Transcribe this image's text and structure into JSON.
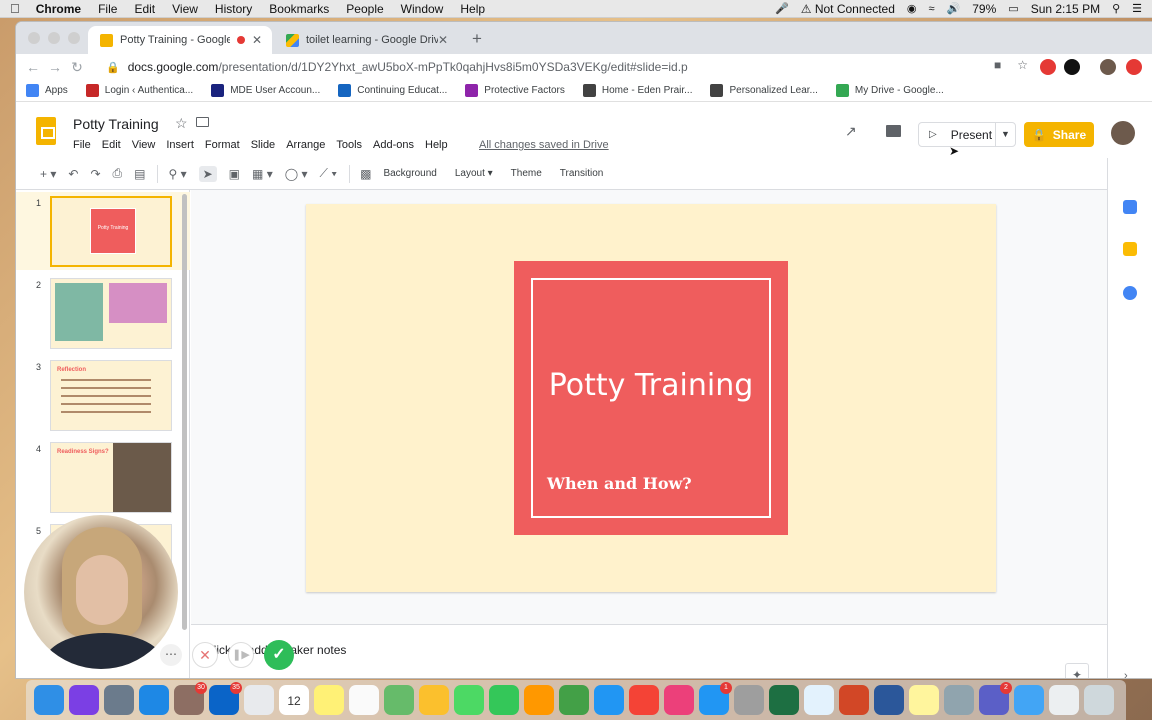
{
  "menubar": {
    "app": "Chrome",
    "items": [
      "File",
      "Edit",
      "View",
      "History",
      "Bookmarks",
      "People",
      "Window",
      "Help"
    ],
    "network": "Not Connected",
    "battery": "79%",
    "clock": "Sun 2:15 PM"
  },
  "browser": {
    "tabs": [
      {
        "title": "Potty Training - Google Sli",
        "favicon_color": "#f4b400"
      },
      {
        "title": "toilet learning - Google Drive",
        "favicon_color": "#34a853"
      }
    ],
    "url_host": "docs.google.com",
    "url_path": "/presentation/d/1DY2Yhxt_awU5boX-mPpTk0qahjHvs8i5m0YSDa3VEKg/edit#slide=id.p",
    "bookmarks": [
      {
        "label": "Apps",
        "color": "#4285f4"
      },
      {
        "label": "Login ‹ Authentica...",
        "color": "#c62828"
      },
      {
        "label": "MDE User Accoun...",
        "color": "#1a237e"
      },
      {
        "label": "Continuing Educat...",
        "color": "#1565c0"
      },
      {
        "label": "Protective Factors",
        "color": "#8e24aa"
      },
      {
        "label": "Home - Eden Prair...",
        "color": "#424242"
      },
      {
        "label": "Personalized Lear...",
        "color": "#424242"
      },
      {
        "label": "My Drive - Google...",
        "color": "#34a853"
      }
    ]
  },
  "slides": {
    "doc_title": "Potty Training",
    "menu": [
      "File",
      "Edit",
      "View",
      "Insert",
      "Format",
      "Slide",
      "Arrange",
      "Tools",
      "Add-ons",
      "Help"
    ],
    "saved_status": "All changes saved in Drive",
    "present_label": "Present",
    "share_label": "Share",
    "toolbar_text": [
      "Background",
      "Layout",
      "Theme",
      "Transition"
    ],
    "slide_title": "Potty Training",
    "slide_subtitle": "When and How?",
    "speaker_notes": "Click to add speaker notes",
    "filmstrip": [
      {
        "num": "1",
        "thumb_text": "Potty Training"
      },
      {
        "num": "2",
        "thumb_text": ""
      },
      {
        "num": "3",
        "thumb_text": "Reflection"
      },
      {
        "num": "4",
        "thumb_text": "Readiness Signs?"
      },
      {
        "num": "5",
        "thumb_text": ""
      }
    ],
    "accent": "#ef5d5d",
    "slide_bg": "#fff2cc"
  },
  "dock": {
    "calendar_day": "12",
    "apps": [
      {
        "name": "finder",
        "color": "#2f8fe6"
      },
      {
        "name": "siri",
        "color": "#7b3fe4"
      },
      {
        "name": "launchpad",
        "color": "#6b7b8c"
      },
      {
        "name": "safari",
        "color": "#1e88e5"
      },
      {
        "name": "preview",
        "color": "#8d6e63",
        "badge": "30"
      },
      {
        "name": "outlook",
        "color": "#0a64c8",
        "badge": "35"
      },
      {
        "name": "chrome",
        "color": "#e8eaed"
      },
      {
        "name": "calendar",
        "color": "#ffffff"
      },
      {
        "name": "notes",
        "color": "#fff176"
      },
      {
        "name": "reminders",
        "color": "#fafafa"
      },
      {
        "name": "maps",
        "color": "#66bb6a"
      },
      {
        "name": "photos",
        "color": "#fbc02d"
      },
      {
        "name": "messages",
        "color": "#4cd964"
      },
      {
        "name": "facetime",
        "color": "#34c759"
      },
      {
        "name": "pages",
        "color": "#ff9800"
      },
      {
        "name": "numbers",
        "color": "#43a047"
      },
      {
        "name": "keynote",
        "color": "#2196f3"
      },
      {
        "name": "news",
        "color": "#f44336"
      },
      {
        "name": "itunes",
        "color": "#ec407a"
      },
      {
        "name": "app-store",
        "color": "#2196f3",
        "badge": "1"
      },
      {
        "name": "system-preferences",
        "color": "#9e9e9e"
      },
      {
        "name": "excel",
        "color": "#1d6f42"
      },
      {
        "name": "textedit",
        "color": "#e3f2fd"
      },
      {
        "name": "powerpoint",
        "color": "#d24726"
      },
      {
        "name": "word",
        "color": "#2b579a"
      },
      {
        "name": "stickies",
        "color": "#fff59d"
      },
      {
        "name": "preview-2",
        "color": "#90a4ae"
      },
      {
        "name": "teams",
        "color": "#5b5fc7",
        "badge": "2"
      },
      {
        "name": "downloads",
        "color": "#42a5f5"
      },
      {
        "name": "documents",
        "color": "#eceff1"
      },
      {
        "name": "trash",
        "color": "#cfd8dc"
      }
    ]
  }
}
